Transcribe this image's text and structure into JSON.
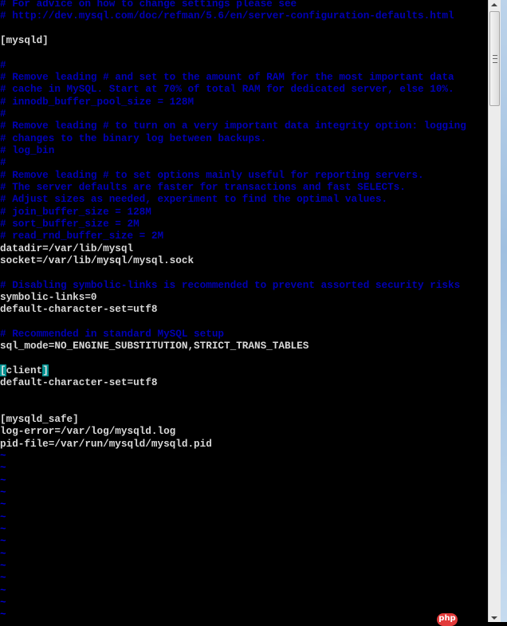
{
  "editor": {
    "lines": [
      {
        "type": "comment",
        "text": "# For advice on how to change settings please see"
      },
      {
        "type": "comment",
        "text": "# http://dev.mysql.com/doc/refman/5.6/en/server-configuration-defaults.html"
      },
      {
        "type": "text",
        "text": ""
      },
      {
        "type": "text",
        "text": "[mysqld]"
      },
      {
        "type": "text",
        "text": ""
      },
      {
        "type": "comment",
        "text": "#"
      },
      {
        "type": "comment",
        "text": "# Remove leading # and set to the amount of RAM for the most important data"
      },
      {
        "type": "comment",
        "text": "# cache in MySQL. Start at 70% of total RAM for dedicated server, else 10%."
      },
      {
        "type": "comment",
        "text": "# innodb_buffer_pool_size = 128M"
      },
      {
        "type": "comment",
        "text": "#"
      },
      {
        "type": "comment",
        "text": "# Remove leading # to turn on a very important data integrity option: logging"
      },
      {
        "type": "comment",
        "text": "# changes to the binary log between backups."
      },
      {
        "type": "comment",
        "text": "# log_bin"
      },
      {
        "type": "comment",
        "text": "#"
      },
      {
        "type": "comment",
        "text": "# Remove leading # to set options mainly useful for reporting servers."
      },
      {
        "type": "comment",
        "text": "# The server defaults are faster for transactions and fast SELECTs."
      },
      {
        "type": "comment",
        "text": "# Adjust sizes as needed, experiment to find the optimal values."
      },
      {
        "type": "comment",
        "text": "# join_buffer_size = 128M"
      },
      {
        "type": "comment",
        "text": "# sort_buffer_size = 2M"
      },
      {
        "type": "comment",
        "text": "# read_rnd_buffer_size = 2M"
      },
      {
        "type": "text",
        "text": "datadir=/var/lib/mysql"
      },
      {
        "type": "text",
        "text": "socket=/var/lib/mysql/mysql.sock"
      },
      {
        "type": "text",
        "text": ""
      },
      {
        "type": "comment",
        "text": "# Disabling symbolic-links is recommended to prevent assorted security risks"
      },
      {
        "type": "text",
        "text": "symbolic-links=0"
      },
      {
        "type": "text",
        "text": "default-character-set=utf8"
      },
      {
        "type": "text",
        "text": ""
      },
      {
        "type": "comment",
        "text": "# Recommended in standard MySQL setup"
      },
      {
        "type": "text",
        "text": "sql_mode=NO_ENGINE_SUBSTITUTION,STRICT_TRANS_TABLES"
      },
      {
        "type": "text",
        "text": ""
      },
      {
        "type": "cursor",
        "open": "[",
        "text": "client",
        "close": "]"
      },
      {
        "type": "text",
        "text": "default-character-set=utf8"
      },
      {
        "type": "text",
        "text": ""
      },
      {
        "type": "text",
        "text": ""
      },
      {
        "type": "text",
        "text": "[mysqld_safe]"
      },
      {
        "type": "text",
        "text": "log-error=/var/log/mysqld.log"
      },
      {
        "type": "text",
        "text": "pid-file=/var/run/mysqld/mysqld.pid"
      },
      {
        "type": "tilde",
        "text": "~"
      },
      {
        "type": "tilde",
        "text": "~"
      },
      {
        "type": "tilde",
        "text": "~"
      },
      {
        "type": "tilde",
        "text": "~"
      },
      {
        "type": "tilde",
        "text": "~"
      },
      {
        "type": "tilde",
        "text": "~"
      },
      {
        "type": "tilde",
        "text": "~"
      },
      {
        "type": "tilde",
        "text": "~"
      },
      {
        "type": "tilde",
        "text": "~"
      },
      {
        "type": "tilde",
        "text": "~"
      },
      {
        "type": "tilde",
        "text": "~"
      },
      {
        "type": "tilde",
        "text": "~"
      },
      {
        "type": "tilde",
        "text": "~"
      },
      {
        "type": "tilde",
        "text": "~"
      }
    ]
  },
  "watermark": "php",
  "colors": {
    "comment": "#0000b4",
    "text": "#d8d8d8",
    "match_bracket": "#009090"
  }
}
